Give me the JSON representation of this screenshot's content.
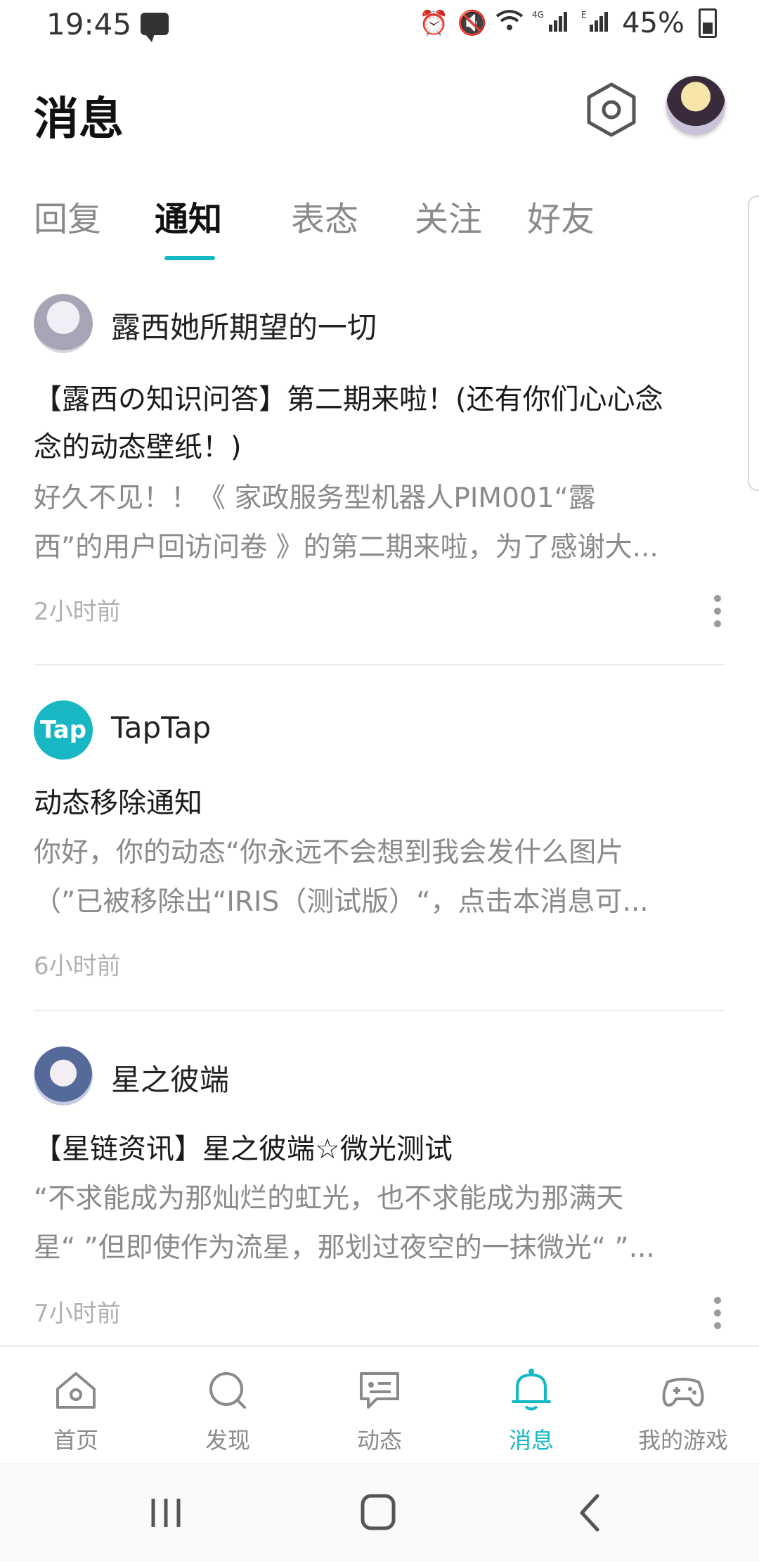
{
  "status_bar": {
    "time": "19:45",
    "icons": [
      "chat-icon",
      "alarm-icon",
      "mute-icon",
      "wifi-icon",
      "4g-icon",
      "signal-icon",
      "signal-e-icon"
    ],
    "battery": "45%"
  },
  "header": {
    "title": "消息"
  },
  "tabs": [
    {
      "label": "回复",
      "active": false
    },
    {
      "label": "通知",
      "active": true
    },
    {
      "label": "表态",
      "active": false
    },
    {
      "label": "关注",
      "active": false
    },
    {
      "label": "好友",
      "active": false
    }
  ],
  "notifications": [
    {
      "sender": "露西她所期望的一切",
      "title": "【露西の知识问答】第二期来啦！(还有你们心心念念的动态壁纸！)",
      "title_lines": [
        "【露西の知识问答】第二期来啦！(还有你们心心念",
        "念的动态壁纸！)"
      ],
      "body_lines": [
        "好久不见！！《 家政服务型机器人PIM001“露",
        "西”的用户回访问卷 》的第二期来啦，为了感谢大..."
      ],
      "time": "2小时前"
    },
    {
      "sender": "TapTap",
      "avatar_text": "Tap",
      "title": "动态移除通知",
      "title_lines": [
        "动态移除通知"
      ],
      "body_lines": [
        "你好，你的动态“你永远不会想到我会发什么图片",
        "（”已被移除出“IRIS（测试版）“，点击本消息可..."
      ],
      "time": "6小时前"
    },
    {
      "sender": "星之彼端",
      "title": "【星链资讯】星之彼端☆微光测试",
      "title_lines": [
        "【星链资讯】星之彼端☆微光测试"
      ],
      "body_lines": [
        "“不求能成为那灿烂的虹光，也不求能成为那满天",
        "星“ ”但即使作为流星，那划过夜空的一抹微光“ ”..."
      ],
      "time": "7小时前"
    }
  ],
  "bottom_nav": [
    {
      "label": "首页",
      "icon": "home-icon",
      "active": false
    },
    {
      "label": "发现",
      "icon": "discover-icon",
      "active": false
    },
    {
      "label": "动态",
      "icon": "feed-icon",
      "active": false
    },
    {
      "label": "消息",
      "icon": "bell-icon",
      "active": true
    },
    {
      "label": "我的游戏",
      "icon": "gamepad-icon",
      "active": false
    }
  ],
  "colors": {
    "accent": "#15b9c3",
    "text_primary": "#1a1a1a",
    "text_secondary": "#8a8a8a",
    "text_time": "#b0b0b0"
  }
}
